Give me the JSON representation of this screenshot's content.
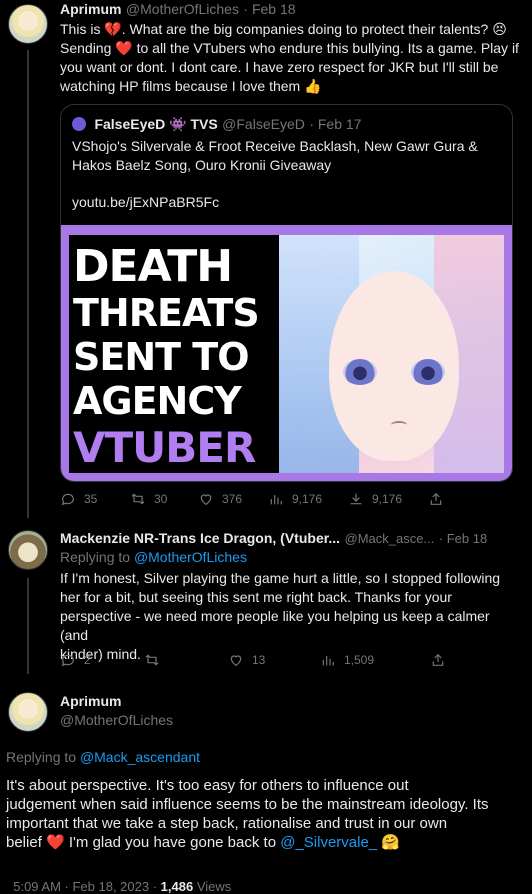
{
  "tweet1": {
    "name": "Aprimum",
    "handle": "@MotherOfLiches",
    "date": "· Feb 18",
    "text_line1": "This is 💔. What are the big companies doing to protect their talents? 😣",
    "text_line2": "Sending ❤️ to all the VTubers who endure this bullying. Its a game. Play if",
    "text_line3": "you want or dont. I dont care. I have zero respect for JKR but I'll still be",
    "text_line4": "watching HP films because I love them 👍",
    "quote": {
      "name": "FalseEyeD 👾 TVS",
      "handle": "@FalseEyeD",
      "date": "· Feb 17",
      "text_line1": "VShojo's Silvervale & Froot Receive Backlash, New Gawr Gura &",
      "text_line2": "Hakos Baelz Song, Ouro Kronii Giveaway",
      "link": "youtu.be/jExNPaBR5Fc",
      "thumbnail_lines": [
        "DEATH",
        "THREATS",
        "SENT TO",
        "AGENCY",
        "VTUBER"
      ]
    },
    "actions": {
      "replies": "35",
      "retweets": "30",
      "likes": "376",
      "views": "9,176",
      "bookmarks": "9,176"
    }
  },
  "tweet2": {
    "name": "Mackenzie NR-Trans Ice Dragon, (Vtuber...",
    "handle": "@Mack_asce...",
    "date": "· Feb 18",
    "replying_prefix": "Replying to",
    "replying_to": "@MotherOfLiches",
    "text_line1": "If I'm honest, Silver playing the game hurt a little, so I stopped following",
    "text_line2": "her for a bit, but seeing this sent me right back. Thanks for your",
    "text_line3": "perspective - we need more people like you helping us keep a calmer (and",
    "text_line4": "kinder) mind.",
    "actions": {
      "replies": "2",
      "retweets": "",
      "likes": "13",
      "views": "1,509"
    }
  },
  "main": {
    "name": "Aprimum",
    "handle": "@MotherOfLiches",
    "replying_prefix": "Replying to",
    "replying_to": "@Mack_ascendant",
    "text_line1": "It's about perspective.  It's too easy for others to influence out",
    "text_line2": "judgement when said influence seems to be the mainstream ideology. Its",
    "text_line3": "important that we take a step back, rationalise and trust in our own",
    "text_line4_a": "belief ❤️ I'm glad you have gone back to ",
    "text_line4_mention": "@_Silvervale_",
    "text_line4_b": " 🤗",
    "timestamp": "5:09 AM · Feb 18, 2023 · ",
    "views_count": "1,486",
    "views_label": " Views"
  },
  "colors": {
    "background": "#000000",
    "accent": "#1d9bf0",
    "text": "#e7e9ea",
    "muted": "#71767b",
    "thumb_frame": "#a778e6",
    "vtuber_word": "#b07ef0"
  }
}
